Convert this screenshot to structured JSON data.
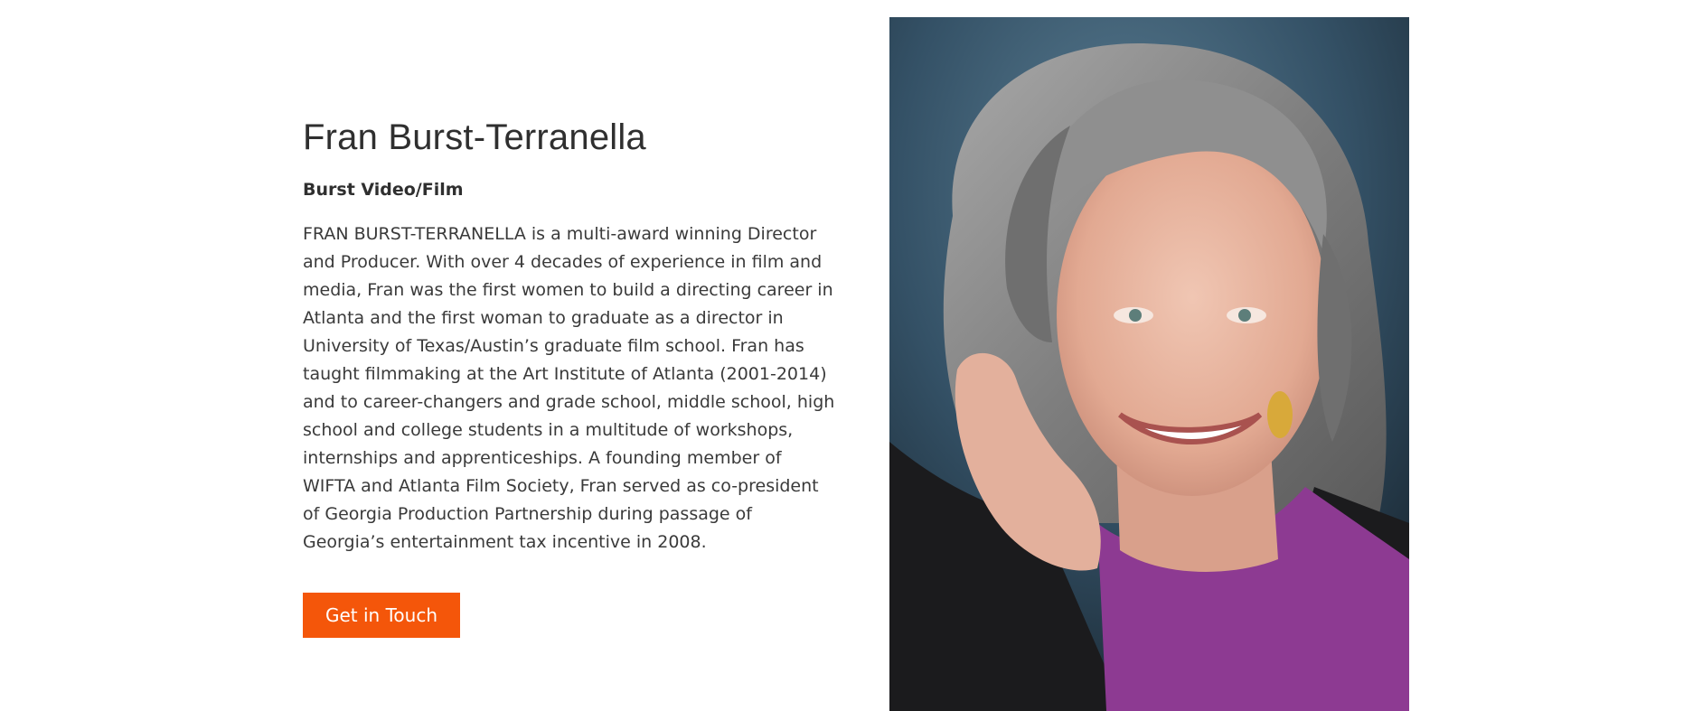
{
  "profile": {
    "name": "Fran Burst-Terranella",
    "company": "Burst Video/Film",
    "bio": "FRAN BURST-TERRANELLA is a multi-award winning Director and Producer. With over 4 decades of experience in film and media, Fran was the first women to build a directing career in Atlanta and the first woman to graduate as a director in University of Texas/Austin’s graduate film school. Fran has taught filmmaking at the Art Institute of Atlanta (2001-2014) and to career-changers and grade school, middle school, high school and college students in a multitude of workshops, internships and apprenticeships. A founding member of WIFTA and Atlanta Film Society, Fran served as co-president of Georgia Production Partnership during passage of Georgia’s entertainment tax incentive in 2008.",
    "cta_label": "Get in Touch"
  },
  "colors": {
    "accent": "#f4560a",
    "text": "#3a3a3a",
    "background": "#ffffff"
  }
}
